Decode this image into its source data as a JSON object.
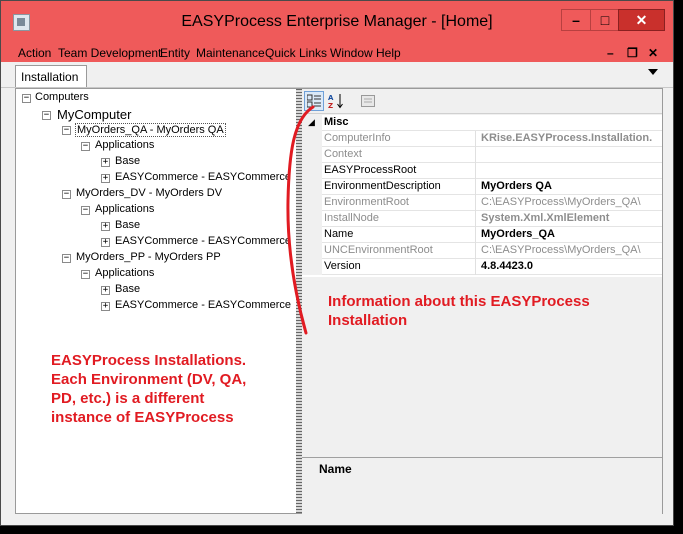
{
  "window": {
    "title": "EASYProcess Enterprise Manager - [Home]"
  },
  "window_controls": {
    "minimize": "–",
    "maximize": "□",
    "close": "✕"
  },
  "menu": [
    {
      "label": "Action"
    },
    {
      "label": "Team Development"
    },
    {
      "label": "Entity"
    },
    {
      "label": "Maintenance"
    },
    {
      "label": "Quick Links"
    },
    {
      "label": "Window"
    },
    {
      "label": "Help"
    }
  ],
  "mdi_controls": {
    "minimize": "–",
    "restore": "❐",
    "close": "✕"
  },
  "tab": {
    "label": "Installation"
  },
  "tree": {
    "root": "Computers",
    "computer": "MyComputer",
    "environments": [
      {
        "label": "MyOrders_QA - MyOrders QA",
        "applications": "Applications",
        "children": [
          "Base",
          "EASYCommerce - EASYCommerce"
        ]
      },
      {
        "label": "MyOrders_DV - MyOrders DV",
        "applications": "Applications",
        "children": [
          "Base",
          "EASYCommerce - EASYCommerce"
        ]
      },
      {
        "label": "MyOrders_PP - MyOrders PP",
        "applications": "Applications",
        "children": [
          "Base",
          "EASYCommerce - EASYCommerce"
        ]
      }
    ]
  },
  "toolbar": {
    "categorized_icon": "categorized-icon",
    "alphabetical_icon": "az-sort-icon",
    "pages_icon": "property-pages-icon"
  },
  "property_grid": {
    "category": "Misc",
    "rows": [
      {
        "name": "ComputerInfo",
        "value": "KRise.EASYProcess.Installation.",
        "readonly": true,
        "bold": true
      },
      {
        "name": "Context",
        "value": "",
        "readonly": true,
        "bold": false
      },
      {
        "name": "EASYProcessRoot",
        "value": "",
        "readonly": false,
        "bold": false
      },
      {
        "name": "EnvironmentDescription",
        "value": "MyOrders QA",
        "readonly": false,
        "bold": true
      },
      {
        "name": "EnvironmentRoot",
        "value": "C:\\EASYProcess\\MyOrders_QA\\",
        "readonly": true,
        "bold": false
      },
      {
        "name": "InstallNode",
        "value": "System.Xml.XmlElement",
        "readonly": true,
        "bold": true
      },
      {
        "name": "Name",
        "value": "MyOrders_QA",
        "readonly": false,
        "bold": true
      },
      {
        "name": "UNCEnvironmentRoot",
        "value": "C:\\EASYProcess\\MyOrders_QA\\",
        "readonly": true,
        "bold": false
      },
      {
        "name": "Version",
        "value": "4.8.4423.0",
        "readonly": false,
        "bold": true
      }
    ]
  },
  "description_panel": {
    "title": "Name"
  },
  "annotations": {
    "left": [
      "EASYProcess Installations.",
      "Each Environment (DV, QA,",
      "PD, etc.) is a different",
      "instance of EASYProcess"
    ],
    "right": [
      "Information about this EASYProcess",
      "Installation"
    ],
    "color": "#e11b22"
  }
}
